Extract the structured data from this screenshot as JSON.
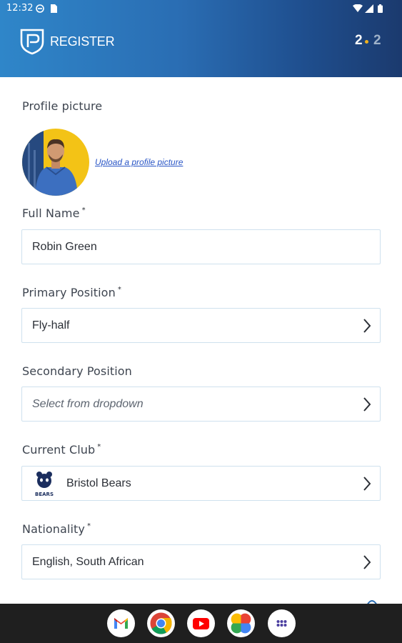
{
  "status_bar": {
    "time": "12:32",
    "left_icons": [
      "notification-dot-icon",
      "sim-card-icon"
    ],
    "right_icons": [
      "wifi-icon",
      "signal-icon",
      "battery-icon"
    ]
  },
  "header": {
    "title": "REGISTER",
    "step_current": "2",
    "step_total": "2",
    "logo": "shield-p-logo",
    "colors": {
      "gradient_start": "#2f86c9",
      "gradient_end": "#1b3a6e",
      "step_dot": "#f0b21d"
    }
  },
  "form": {
    "profile_picture": {
      "label": "Profile picture",
      "upload_link": "Upload a profile picture"
    },
    "full_name": {
      "label": "Full Name",
      "required_mark": "*",
      "value": "Robin Green"
    },
    "primary_position": {
      "label": "Primary Position",
      "required_mark": "*",
      "value": "Fly-half"
    },
    "secondary_position": {
      "label": "Secondary Position",
      "placeholder": "Select from dropdown"
    },
    "current_club": {
      "label": "Current Club",
      "required_mark": "*",
      "value": "Bristol Bears",
      "crest_text": "BEARS"
    },
    "nationality": {
      "label": "Nationality",
      "required_mark": "*",
      "value": "English, South African"
    }
  },
  "dock": {
    "apps": [
      "gmail-icon",
      "chrome-icon",
      "youtube-icon",
      "photos-icon",
      "app-drawer-icon"
    ]
  }
}
